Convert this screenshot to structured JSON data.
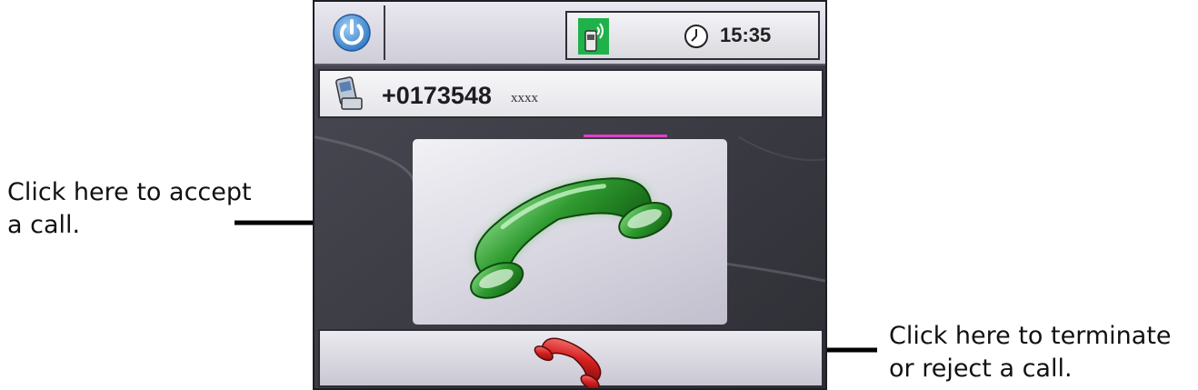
{
  "annotations": {
    "accept": "Click here to accept\na call.",
    "reject": "Click here to terminate\nor reject a call."
  },
  "status_bar": {
    "time": "15:35",
    "icons": [
      "power-icon",
      "signal-icon",
      "clock-icon"
    ]
  },
  "caller": {
    "number": "+0173548",
    "suffix": "xxxx",
    "icon": "mobile-phone-icon"
  },
  "buttons": {
    "accept_icon": "green-phone-handset-icon",
    "reject_icon": "red-phone-handset-icon"
  },
  "colors": {
    "accept": "#2f9a2f",
    "reject": "#d42020",
    "power": "#3f8fd8",
    "accent": "#e040c8"
  }
}
